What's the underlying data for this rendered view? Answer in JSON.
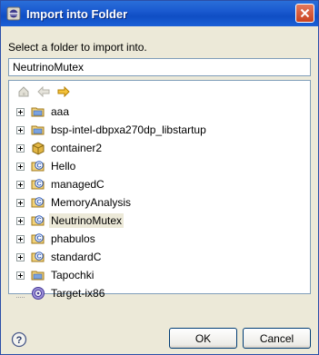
{
  "window": {
    "title": "Import into Folder",
    "icon": "eclipse-icon"
  },
  "instruction": "Select a folder to import into.",
  "folder_input": {
    "value": "NeutrinoMutex"
  },
  "toolbar": {
    "buttons": [
      {
        "icon": "home-icon",
        "enabled": false
      },
      {
        "icon": "back-arrow-icon",
        "enabled": false
      },
      {
        "icon": "forward-arrow-icon",
        "enabled": true
      }
    ]
  },
  "tree": {
    "items": [
      {
        "label": "aaa",
        "icon": "project-folder-icon",
        "expandable": true,
        "selected": false
      },
      {
        "label": "bsp-intel-dbpxa270dp_libstartup",
        "icon": "project-folder-icon",
        "expandable": true,
        "selected": false
      },
      {
        "label": "container2",
        "icon": "container-icon",
        "expandable": true,
        "selected": false
      },
      {
        "label": "Hello",
        "icon": "c-project-icon",
        "expandable": true,
        "selected": false
      },
      {
        "label": "managedC",
        "icon": "c-project-icon",
        "expandable": true,
        "selected": false
      },
      {
        "label": "MemoryAnalysis",
        "icon": "c-project-icon",
        "expandable": true,
        "selected": false
      },
      {
        "label": "NeutrinoMutex",
        "icon": "c-project-icon",
        "expandable": true,
        "selected": true
      },
      {
        "label": "phabulos",
        "icon": "c-project-icon",
        "expandable": true,
        "selected": false
      },
      {
        "label": "standardC",
        "icon": "c-project-icon",
        "expandable": true,
        "selected": false
      },
      {
        "label": "Tapochki",
        "icon": "project-folder-icon",
        "expandable": true,
        "selected": false
      },
      {
        "label": "Target-ix86",
        "icon": "target-icon",
        "expandable": false,
        "selected": false
      }
    ]
  },
  "buttons": {
    "help_icon": "help-icon",
    "ok": "OK",
    "cancel": "Cancel"
  }
}
